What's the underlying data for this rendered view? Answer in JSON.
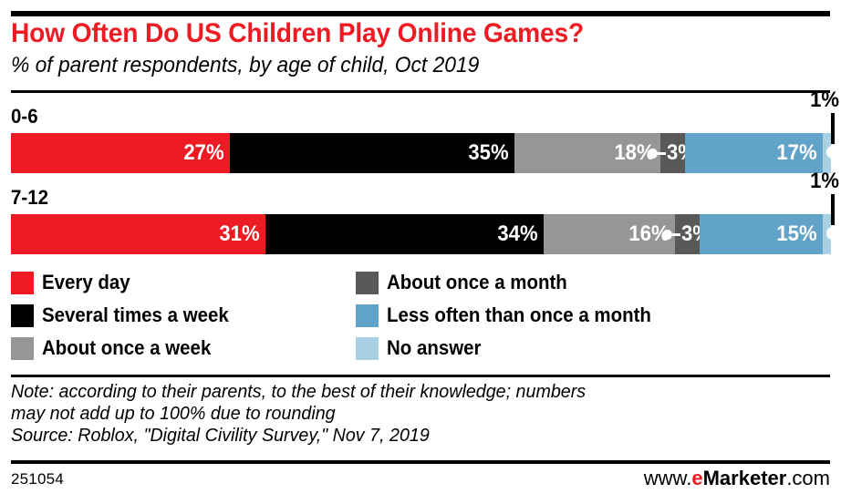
{
  "header": {
    "title": "How Often Do US Children Play Online Games?",
    "subtitle": "% of parent respondents, by age of child, Oct 2019"
  },
  "chart_data": {
    "type": "bar",
    "orientation": "horizontal",
    "stacked": true,
    "stacked_percent": true,
    "title": "How Often Do US Children Play Online Games?",
    "subtitle": "% of parent respondents, by age of child, Oct 2019",
    "xlabel": "",
    "ylabel": "",
    "xlim": [
      0,
      101
    ],
    "grid": false,
    "legend_position": "below",
    "categories": [
      "0-6",
      "7-12"
    ],
    "series": [
      {
        "name": "Every day",
        "color": "#ed1c24",
        "values": [
          27,
          31
        ],
        "labels": [
          "27%",
          "31%"
        ]
      },
      {
        "name": "Several times a week",
        "color": "#000000",
        "values": [
          35,
          34
        ],
        "labels": [
          "35%",
          "34%"
        ]
      },
      {
        "name": "About once a week",
        "color": "#969696",
        "values": [
          18,
          16
        ],
        "labels": [
          "18%",
          "16%"
        ]
      },
      {
        "name": "About once a month",
        "color": "#595959",
        "values": [
          3,
          3
        ],
        "labels": [
          "3%",
          "3%"
        ]
      },
      {
        "name": "Less often than once a month",
        "color": "#62a3c9",
        "values": [
          17,
          15
        ],
        "labels": [
          "17%",
          "15%"
        ]
      },
      {
        "name": "No answer",
        "color": "#a8d2e3",
        "values": [
          1,
          1
        ],
        "labels": [
          "1%",
          "1%"
        ]
      }
    ],
    "rows": [
      {
        "label": "0-6",
        "segments": [
          {
            "name": "Every day",
            "value": 27,
            "label": "27%",
            "color": "#ed1c24",
            "label_placement": "inside"
          },
          {
            "name": "Several times a week",
            "value": 35,
            "label": "35%",
            "color": "#000000",
            "label_placement": "inside"
          },
          {
            "name": "About once a week",
            "value": 18,
            "label": "18%",
            "color": "#969696",
            "label_placement": "inside"
          },
          {
            "name": "About once a month",
            "value": 3,
            "label": "3%",
            "color": "#595959",
            "label_placement": "callout-right"
          },
          {
            "name": "Less often than once a month",
            "value": 17,
            "label": "17%",
            "color": "#62a3c9",
            "label_placement": "inside"
          },
          {
            "name": "No answer",
            "value": 1,
            "label": "1%",
            "color": "#a8d2e3",
            "label_placement": "callout-above"
          }
        ]
      },
      {
        "label": "7-12",
        "segments": [
          {
            "name": "Every day",
            "value": 31,
            "label": "31%",
            "color": "#ed1c24",
            "label_placement": "inside"
          },
          {
            "name": "Several times a week",
            "value": 34,
            "label": "34%",
            "color": "#000000",
            "label_placement": "inside"
          },
          {
            "name": "About once a week",
            "value": 16,
            "label": "16%",
            "color": "#969696",
            "label_placement": "inside"
          },
          {
            "name": "About once a month",
            "value": 3,
            "label": "3%",
            "color": "#595959",
            "label_placement": "callout-right"
          },
          {
            "name": "Less often than once a month",
            "value": 15,
            "label": "15%",
            "color": "#62a3c9",
            "label_placement": "inside"
          },
          {
            "name": "No answer",
            "value": 1,
            "label": "1%",
            "color": "#a8d2e3",
            "label_placement": "callout-above"
          }
        ]
      }
    ]
  },
  "legend": {
    "column1": [
      {
        "label": "Every day",
        "color": "#ed1c24"
      },
      {
        "label": "Several times a week",
        "color": "#000000"
      },
      {
        "label": "About once a week",
        "color": "#969696"
      }
    ],
    "column2": [
      {
        "label": "About once a month",
        "color": "#595959"
      },
      {
        "label": "Less often than once a month",
        "color": "#62a3c9"
      },
      {
        "label": "No answer",
        "color": "#a8d2e3"
      }
    ]
  },
  "note": {
    "line1": "Note: according to their parents, to the best of their knowledge; numbers",
    "line2": "may not add up to 100% due to rounding",
    "line3": "Source: Roblox, \"Digital Civility Survey,\" Nov 7, 2019"
  },
  "footer": {
    "chart_id": "251054",
    "brand_prefix": "www.",
    "brand_e": "e",
    "brand_name": "Marketer",
    "brand_suffix": ".com"
  },
  "colors": {
    "accent_red": "#ed1c24",
    "black": "#000000",
    "gray": "#969696",
    "dark_gray": "#595959",
    "blue": "#62a3c9",
    "light_blue": "#a8d2e3",
    "white": "#ffffff"
  }
}
